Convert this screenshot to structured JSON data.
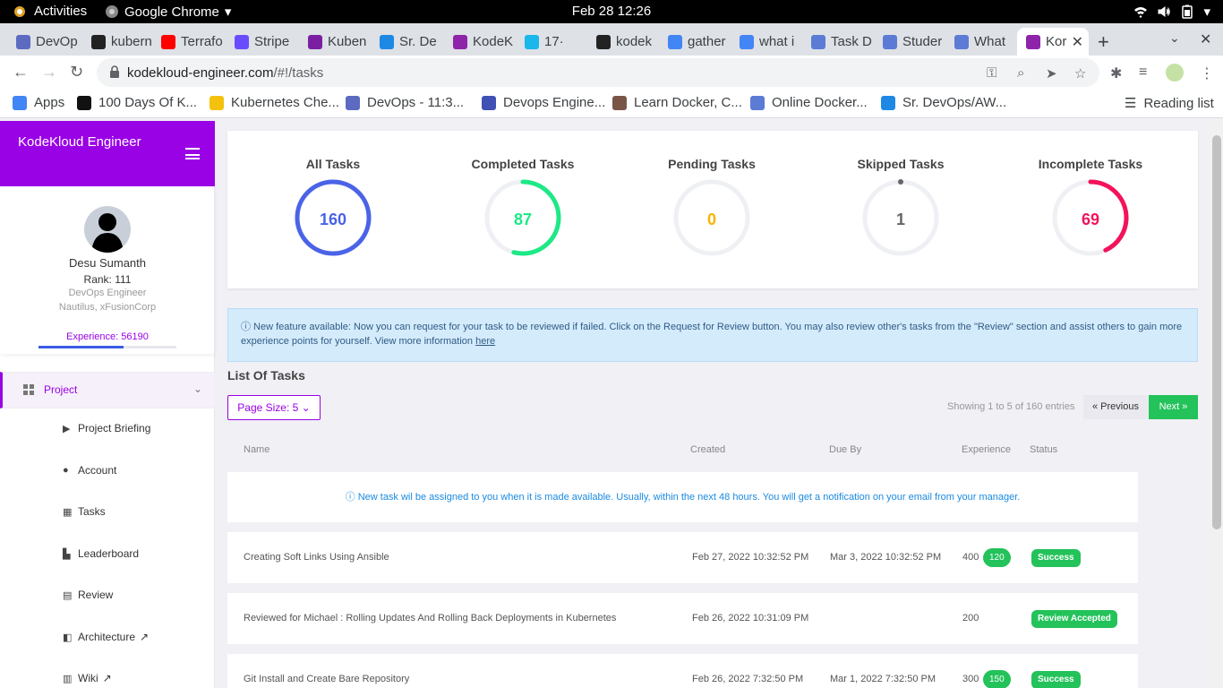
{
  "gnome": {
    "activities": "Activities",
    "app_name": "Google Chrome",
    "clock": "Feb 28  12:26"
  },
  "browser": {
    "tabs": [
      {
        "label": "DevOp",
        "fav_color": "#5c6bc0"
      },
      {
        "label": "kubern",
        "fav_color": "#222222"
      },
      {
        "label": "Terrafo",
        "fav_color": "#ff0000"
      },
      {
        "label": "Stripe",
        "fav_color": "#6a4cff"
      },
      {
        "label": "Kuben",
        "fav_color": "#7b1fa2"
      },
      {
        "label": "Sr. De",
        "fav_color": "#1e88e5"
      },
      {
        "label": "KodeK",
        "fav_color": "#8e24aa"
      },
      {
        "label": "17·",
        "fav_color": "#1ab7ea"
      },
      {
        "label": "kodek",
        "fav_color": "#222222"
      },
      {
        "label": "gather",
        "fav_color": "#4285f4"
      },
      {
        "label": "what i",
        "fav_color": "#4285f4"
      },
      {
        "label": "Task D",
        "fav_color": "#5b7bd5"
      },
      {
        "label": "Studer",
        "fav_color": "#5b7bd5"
      },
      {
        "label": "What",
        "fav_color": "#5b7bd5"
      },
      {
        "label": "Kor",
        "fav_color": "#8e24aa"
      }
    ],
    "url_host": "kodekloud-engineer.com",
    "url_path": "/#!/tasks",
    "bookmarks": [
      {
        "label": "Apps",
        "fav_color": "#4285f4"
      },
      {
        "label": "100 Days Of K...",
        "fav_color": "#111111"
      },
      {
        "label": "Kubernetes Che...",
        "fav_color": "#f4c20d"
      },
      {
        "label": "DevOps - 11:3...",
        "fav_color": "#5c6bc0"
      },
      {
        "label": "Devops Engine...",
        "fav_color": "#3f51b5"
      },
      {
        "label": "Learn Docker, C...",
        "fav_color": "#795548"
      },
      {
        "label": "Online Docker...",
        "fav_color": "#5b7bd5"
      },
      {
        "label": "Sr. DevOps/AW...",
        "fav_color": "#1e88e5"
      }
    ],
    "reading_list": "Reading list"
  },
  "sidebar": {
    "brand": "KodeKloud Engineer",
    "user": {
      "name": "Desu Sumanth",
      "rank": "Rank: 111",
      "role": "DevOps Engineer",
      "org": "Nautilus, xFusionCorp",
      "experience": "Experience: 56190",
      "xp_progress": 0.62
    },
    "project_label": "Project",
    "items": [
      {
        "label": "Project Briefing",
        "icon": "video-icon"
      },
      {
        "label": "Account",
        "icon": "user-icon"
      },
      {
        "label": "Tasks",
        "icon": "table-icon"
      },
      {
        "label": "Leaderboard",
        "icon": "chart-icon"
      },
      {
        "label": "Review",
        "icon": "document-icon"
      },
      {
        "label": "Architecture",
        "icon": "grid-icon"
      },
      {
        "label": "Wiki",
        "icon": "book-icon"
      }
    ]
  },
  "stats": [
    {
      "label": "All Tasks",
      "value": "160",
      "color": "#4a63e7",
      "fraction": 1.0
    },
    {
      "label": "Completed Tasks",
      "value": "87",
      "color": "#1de986",
      "fraction": 0.54
    },
    {
      "label": "Pending Tasks",
      "value": "0",
      "color": "#f7b500",
      "fraction": 0.0
    },
    {
      "label": "Skipped Tasks",
      "value": "1",
      "color": "#666666",
      "fraction": 0.006
    },
    {
      "label": "Incomplete Tasks",
      "value": "69",
      "color": "#f3135a",
      "fraction": 0.43
    }
  ],
  "alert": {
    "text": "ⓘ New feature available: Now you can request for your task to be reviewed if failed. Click on the Request for Review button. You may also review other's tasks from the \"Review\" section and assist others to gain more experience points for yourself. View more information ",
    "link": "here"
  },
  "tasks": {
    "title": "List Of Tasks",
    "page_size": "Page Size: 5 ⌄",
    "showing": "Showing 1 to 5 of 160 entries",
    "prev": "« Previous",
    "next": "Next »",
    "headers": {
      "name": "Name",
      "created": "Created",
      "due": "Due By",
      "experience": "Experience",
      "status": "Status"
    },
    "notice": "ⓘ New task wil be assigned to you when it is made available. Usually, within the next 48 hours. You will get a notification on your email from your manager.",
    "rows": [
      {
        "name": "Creating Soft Links Using Ansible",
        "created": "Feb 27, 2022 10:32:52 PM",
        "due": "Mar 3, 2022 10:32:52 PM",
        "experience": "400",
        "bonus": "120",
        "status": "Success"
      },
      {
        "name": "Reviewed for Michael : Rolling Updates And Rolling Back Deployments in Kubernetes",
        "created": "Feb 26, 2022 10:31:09 PM",
        "due": "",
        "experience": "200",
        "bonus": "",
        "status": "Review Accepted"
      },
      {
        "name": "Git Install and Create Bare Repository",
        "created": "Feb 26, 2022 7:32:50 PM",
        "due": "Mar 1, 2022 7:32:50 PM",
        "experience": "300",
        "bonus": "150",
        "status": "Success"
      }
    ]
  }
}
